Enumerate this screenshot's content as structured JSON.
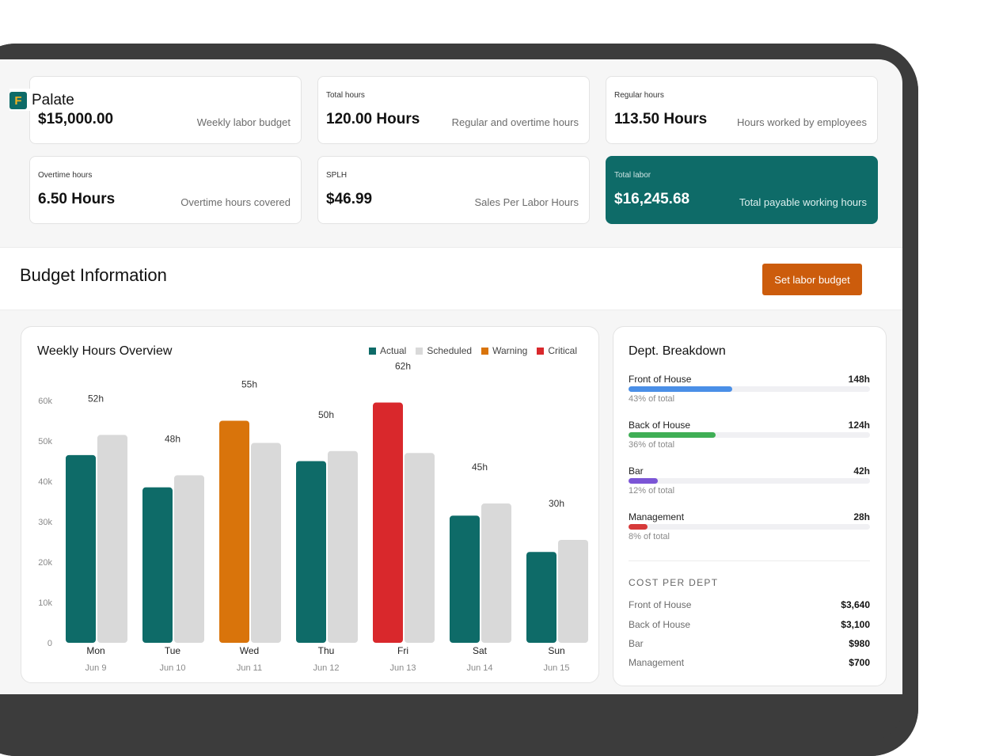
{
  "app": {
    "name": "Palate",
    "logo_letter": "F"
  },
  "stats": [
    {
      "label": "",
      "value": "$15,000.00",
      "desc": "Weekly labor budget",
      "visible_value": "$15,000.00"
    },
    {
      "label": "Total hours",
      "value": "120.00 Hours",
      "desc": "Regular and overtime hours"
    },
    {
      "label": "Regular hours",
      "value": "113.50 Hours",
      "desc": "Hours worked by employees"
    },
    {
      "label": "Overtime hours",
      "value": "6.50 Hours",
      "desc": "Overtime hours covered"
    },
    {
      "label": "SPLH",
      "value": "$46.99",
      "desc": "Sales Per Labor Hours"
    },
    {
      "label": "Total labor",
      "value": "$16,245.68",
      "desc": "Total payable working hours"
    }
  ],
  "budget": {
    "title": "Budget Information",
    "button": "Set labor budget"
  },
  "chart_panel": {
    "title": "Weekly Hours Overview"
  },
  "chart_data": {
    "type": "bar",
    "title": "Weekly Hours Overview",
    "legend": [
      "Actual",
      "Scheduled",
      "Warning",
      "Critical"
    ],
    "legend_colors": {
      "Actual": "#0e6b68",
      "Scheduled": "#d9d9d9",
      "Warning": "#d9740b",
      "Critical": "#d9282c"
    },
    "y_ticks": [
      "0",
      "10k",
      "20k",
      "30k",
      "40k",
      "50k",
      "60k"
    ],
    "ylim": [
      0,
      60
    ],
    "categories": [
      {
        "day": "Mon",
        "date": "Jun 9",
        "label": "52h",
        "actual": 46.5,
        "scheduled": 51.5,
        "status": "Actual"
      },
      {
        "day": "Tue",
        "date": "Jun 10",
        "label": "48h",
        "actual": 38.5,
        "scheduled": 41.5,
        "status": "Actual"
      },
      {
        "day": "Wed",
        "date": "Jun 11",
        "label": "55h",
        "actual": 55,
        "scheduled": 49.5,
        "status": "Warning"
      },
      {
        "day": "Thu",
        "date": "Jun 12",
        "label": "50h",
        "actual": 45,
        "scheduled": 47.5,
        "status": "Actual"
      },
      {
        "day": "Fri",
        "date": "Jun 13",
        "label": "62h",
        "actual": 59.5,
        "scheduled": 47,
        "status": "Critical"
      },
      {
        "day": "Sat",
        "date": "Jun 14",
        "label": "45h",
        "actual": 31.5,
        "scheduled": 34.5,
        "status": "Actual"
      },
      {
        "day": "Sun",
        "date": "Jun 15",
        "label": "30h",
        "actual": 22.5,
        "scheduled": 25.5,
        "status": "Actual"
      }
    ]
  },
  "dept": {
    "title": "Dept. Breakdown",
    "items": [
      {
        "name": "Front of House",
        "hours": "148h",
        "pct_text": "43% of total",
        "pct": 0.43,
        "color": "#4a8fe7"
      },
      {
        "name": "Back of House",
        "hours": "124h",
        "pct_text": "36% of total",
        "pct": 0.36,
        "color": "#3fae55"
      },
      {
        "name": "Bar",
        "hours": "42h",
        "pct_text": "12% of total",
        "pct": 0.12,
        "color": "#7b55d6"
      },
      {
        "name": "Management",
        "hours": "28h",
        "pct_text": "8% of total",
        "pct": 0.08,
        "color": "#d63a3a"
      }
    ],
    "cost_title": "COST PER DEPT",
    "costs": [
      {
        "name": "Front of House",
        "value": "$3,640"
      },
      {
        "name": "Back of House",
        "value": "$3,100"
      },
      {
        "name": "Bar",
        "value": "$980"
      },
      {
        "name": "Management",
        "value": "$700"
      }
    ]
  }
}
